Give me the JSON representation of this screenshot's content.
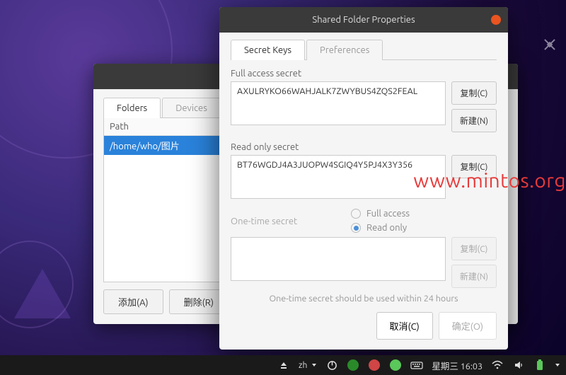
{
  "dialog": {
    "title": "Shared Folder Properties",
    "tabs": {
      "secret_keys": "Secret Keys",
      "preferences": "Preferences"
    },
    "full_access": {
      "label": "Full access secret",
      "value": "AXULRYKO66WAHJALK7ZWYBUS4ZQS2FEAL",
      "copy": "复制(C)",
      "new": "新建(N)"
    },
    "read_only": {
      "label": "Read only secret",
      "value": "BT76WGDJ4A3JUOPW4SGIQ4Y5PJ4X3Y356",
      "copy": "复制(C)"
    },
    "one_time": {
      "label": "One-time secret",
      "radio_full": "Full access",
      "radio_read": "Read only",
      "copy": "复制(C)",
      "new": "新建(N)",
      "hint": "One-time secret should be used within 24 hours"
    },
    "buttons": {
      "cancel": "取消(C)",
      "ok": "确定(O)"
    }
  },
  "back_window": {
    "tabs": {
      "folders": "Folders",
      "devices": "Devices"
    },
    "path_header": "Path",
    "rows": [
      "/home/who/图片"
    ],
    "add": "添加(A)",
    "delete": "删除(R)"
  },
  "taskbar": {
    "ime": "zh",
    "date": "星期三 16:03"
  },
  "watermark": "www.mintos.org",
  "colors": {
    "accent": "#e95420",
    "select": "#2a82da",
    "radio": "#4a90d9"
  }
}
